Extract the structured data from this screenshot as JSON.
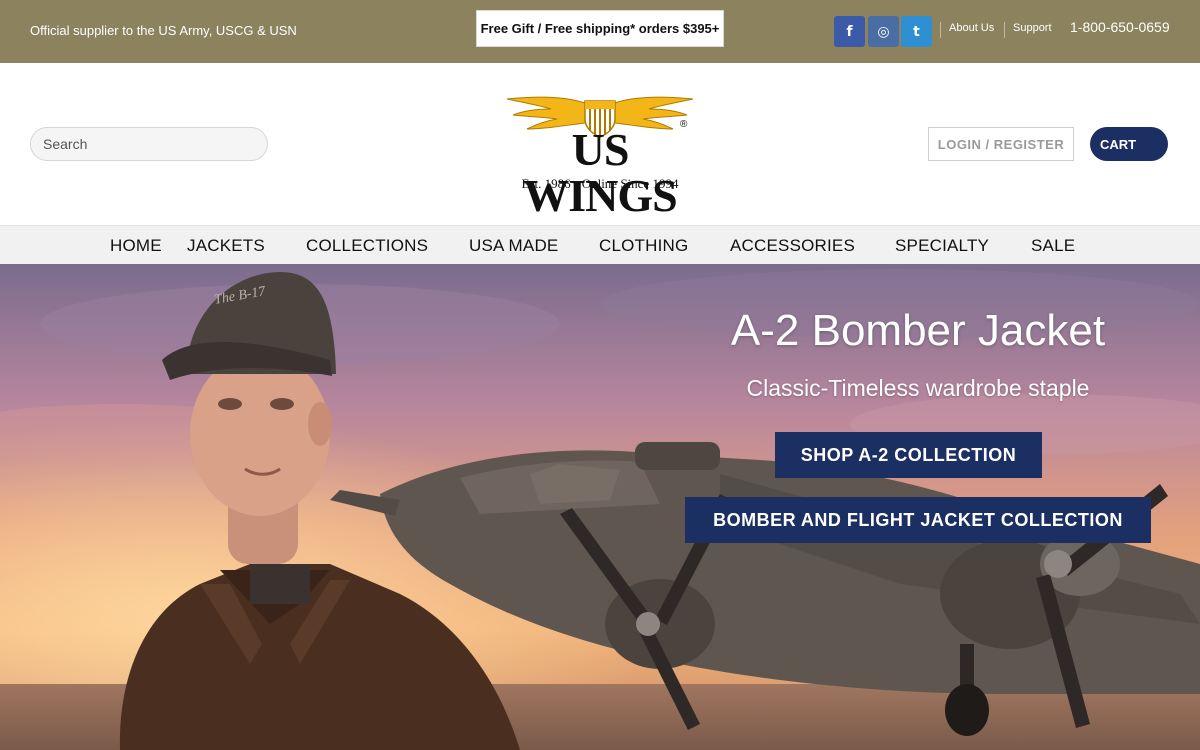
{
  "topbar": {
    "supplier_text": "Official supplier to the US Army, USCG & USN",
    "promo_text": "Free Gift / Free shipping* orders $395+",
    "social": [
      {
        "icon": "facebook-icon",
        "glyph": "f"
      },
      {
        "icon": "instagram-icon",
        "glyph": "◎"
      },
      {
        "icon": "twitter-icon",
        "glyph": "t"
      }
    ],
    "about_label": "About Us",
    "support_label": "Support",
    "phone": "1-800-650-0659",
    "bg_color": "#8c835e"
  },
  "header": {
    "search_placeholder": "Search",
    "logo": {
      "wordmark": "US WINGS",
      "registered": "®",
      "tagline": "Est. 1986 • Online Since 1994"
    },
    "login_label": "LOGIN / REGISTER",
    "cart_label": "CART",
    "accent_color": "#1c2f63"
  },
  "nav": {
    "items": [
      "HOME",
      "JACKETS",
      "COLLECTIONS",
      "USA MADE",
      "CLOTHING",
      "ACCESSORIES",
      "SPECIALTY",
      "SALE"
    ]
  },
  "hero": {
    "title": "A-2 Bomber Jacket",
    "subtitle": "Classic-Timeless wardrobe staple",
    "button_primary": "SHOP A-2 COLLECTION",
    "button_secondary": "BOMBER AND FLIGHT JACKET COLLECTION",
    "cap_text": "The B-17"
  }
}
